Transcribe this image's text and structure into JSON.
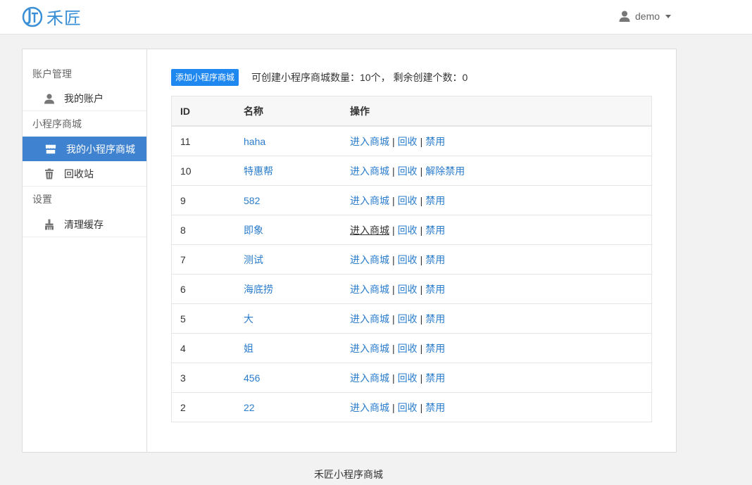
{
  "brand": {
    "name": "禾匠",
    "accent": "#3a8fd6"
  },
  "user": {
    "name": "demo"
  },
  "sidebar": {
    "groups": [
      {
        "title": "账户管理",
        "items": [
          {
            "label": "我的账户",
            "icon": "user-icon"
          }
        ]
      },
      {
        "title": "小程序商城",
        "items": [
          {
            "label": "我的小程序商城",
            "icon": "store-icon",
            "active": true
          },
          {
            "label": "回收站",
            "icon": "trash-icon"
          }
        ]
      },
      {
        "title": "设置",
        "items": [
          {
            "label": "清理缓存",
            "icon": "brush-icon"
          }
        ]
      }
    ]
  },
  "toolbar": {
    "add_label": "添加小程序商城",
    "quota_text": "可创建小程序商城数量：10个， 剩余创建个数：0"
  },
  "table": {
    "headers": {
      "id": "ID",
      "name": "名称",
      "actions": "操作"
    },
    "rows": [
      {
        "id": "11",
        "name": "haha",
        "actions": [
          "进入商城",
          "回收",
          "禁用"
        ]
      },
      {
        "id": "10",
        "name": "特惠帮",
        "actions": [
          "进入商城",
          "回收",
          "解除禁用"
        ]
      },
      {
        "id": "9",
        "name": "582",
        "actions": [
          "进入商城",
          "回收",
          "禁用"
        ]
      },
      {
        "id": "8",
        "name": "即象",
        "actions": [
          "进入商城",
          "回收",
          "禁用"
        ],
        "hover_first": true
      },
      {
        "id": "7",
        "name": "测试",
        "actions": [
          "进入商城",
          "回收",
          "禁用"
        ]
      },
      {
        "id": "6",
        "name": "海底捞",
        "actions": [
          "进入商城",
          "回收",
          "禁用"
        ]
      },
      {
        "id": "5",
        "name": "大",
        "actions": [
          "进入商城",
          "回收",
          "禁用"
        ]
      },
      {
        "id": "4",
        "name": "姐",
        "actions": [
          "进入商城",
          "回收",
          "禁用"
        ]
      },
      {
        "id": "3",
        "name": "456",
        "actions": [
          "进入商城",
          "回收",
          "禁用"
        ]
      },
      {
        "id": "2",
        "name": "22",
        "actions": [
          "进入商城",
          "回收",
          "禁用"
        ]
      }
    ]
  },
  "footer": {
    "text": "禾匠小程序商城"
  }
}
